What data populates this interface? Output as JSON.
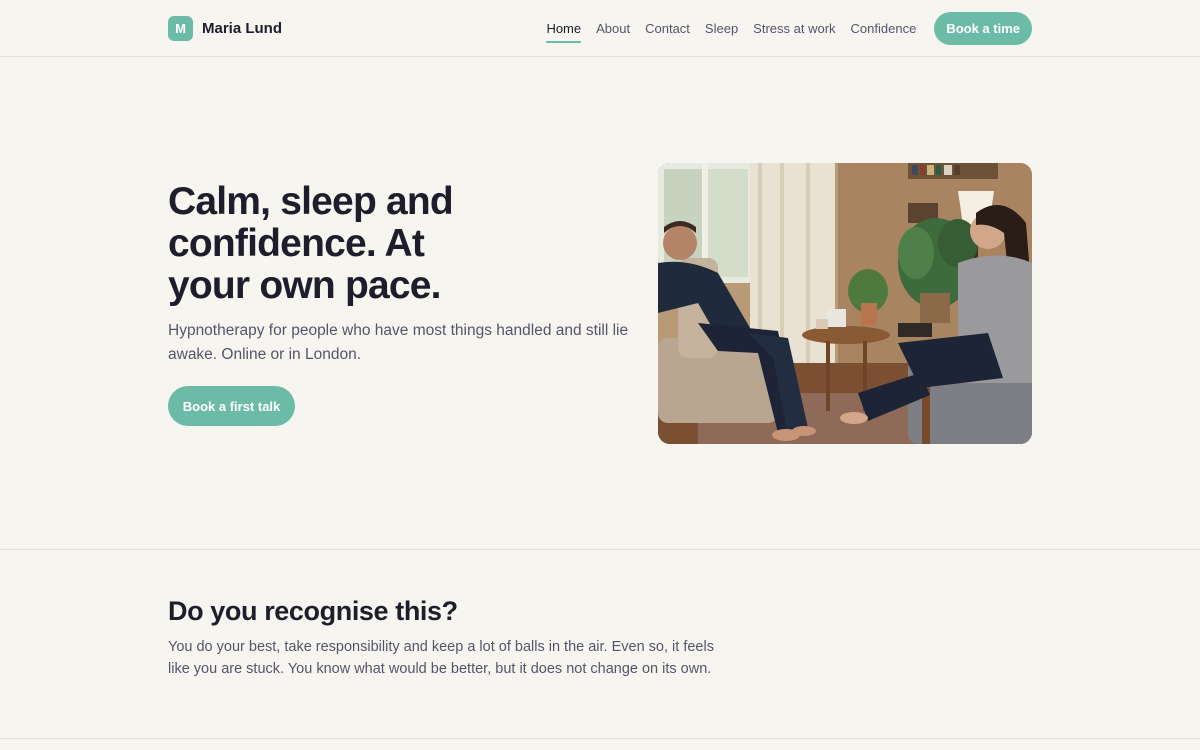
{
  "brand": {
    "logo_letter": "M",
    "name": "Maria Lund"
  },
  "nav": {
    "items": [
      {
        "label": "Home",
        "active": true
      },
      {
        "label": "About",
        "active": false
      },
      {
        "label": "Contact",
        "active": false
      },
      {
        "label": "Sleep",
        "active": false
      },
      {
        "label": "Stress at work",
        "active": false
      },
      {
        "label": "Confidence",
        "active": false
      }
    ],
    "cta_label": "Book a time"
  },
  "hero": {
    "title": "Calm, sleep and confidence. At your own pace.",
    "subtitle": "Hypnotherapy for people who have most things handled and still lie awake. Online or in London.",
    "cta_label": "Book a first talk",
    "image_icon": "therapy-session-photo"
  },
  "section": {
    "title": "Do you recognise this?",
    "body": "You do your best, take responsibility and keep a lot of balls in the air. Even so, it feels like you are stuck. You know what would be better, but it does not change on its own."
  },
  "colors": {
    "accent": "#6cbba7",
    "background": "#f7f5f0",
    "text_dark": "#1f1d2b",
    "text_muted": "#57546a",
    "divider": "#e4e1da"
  }
}
